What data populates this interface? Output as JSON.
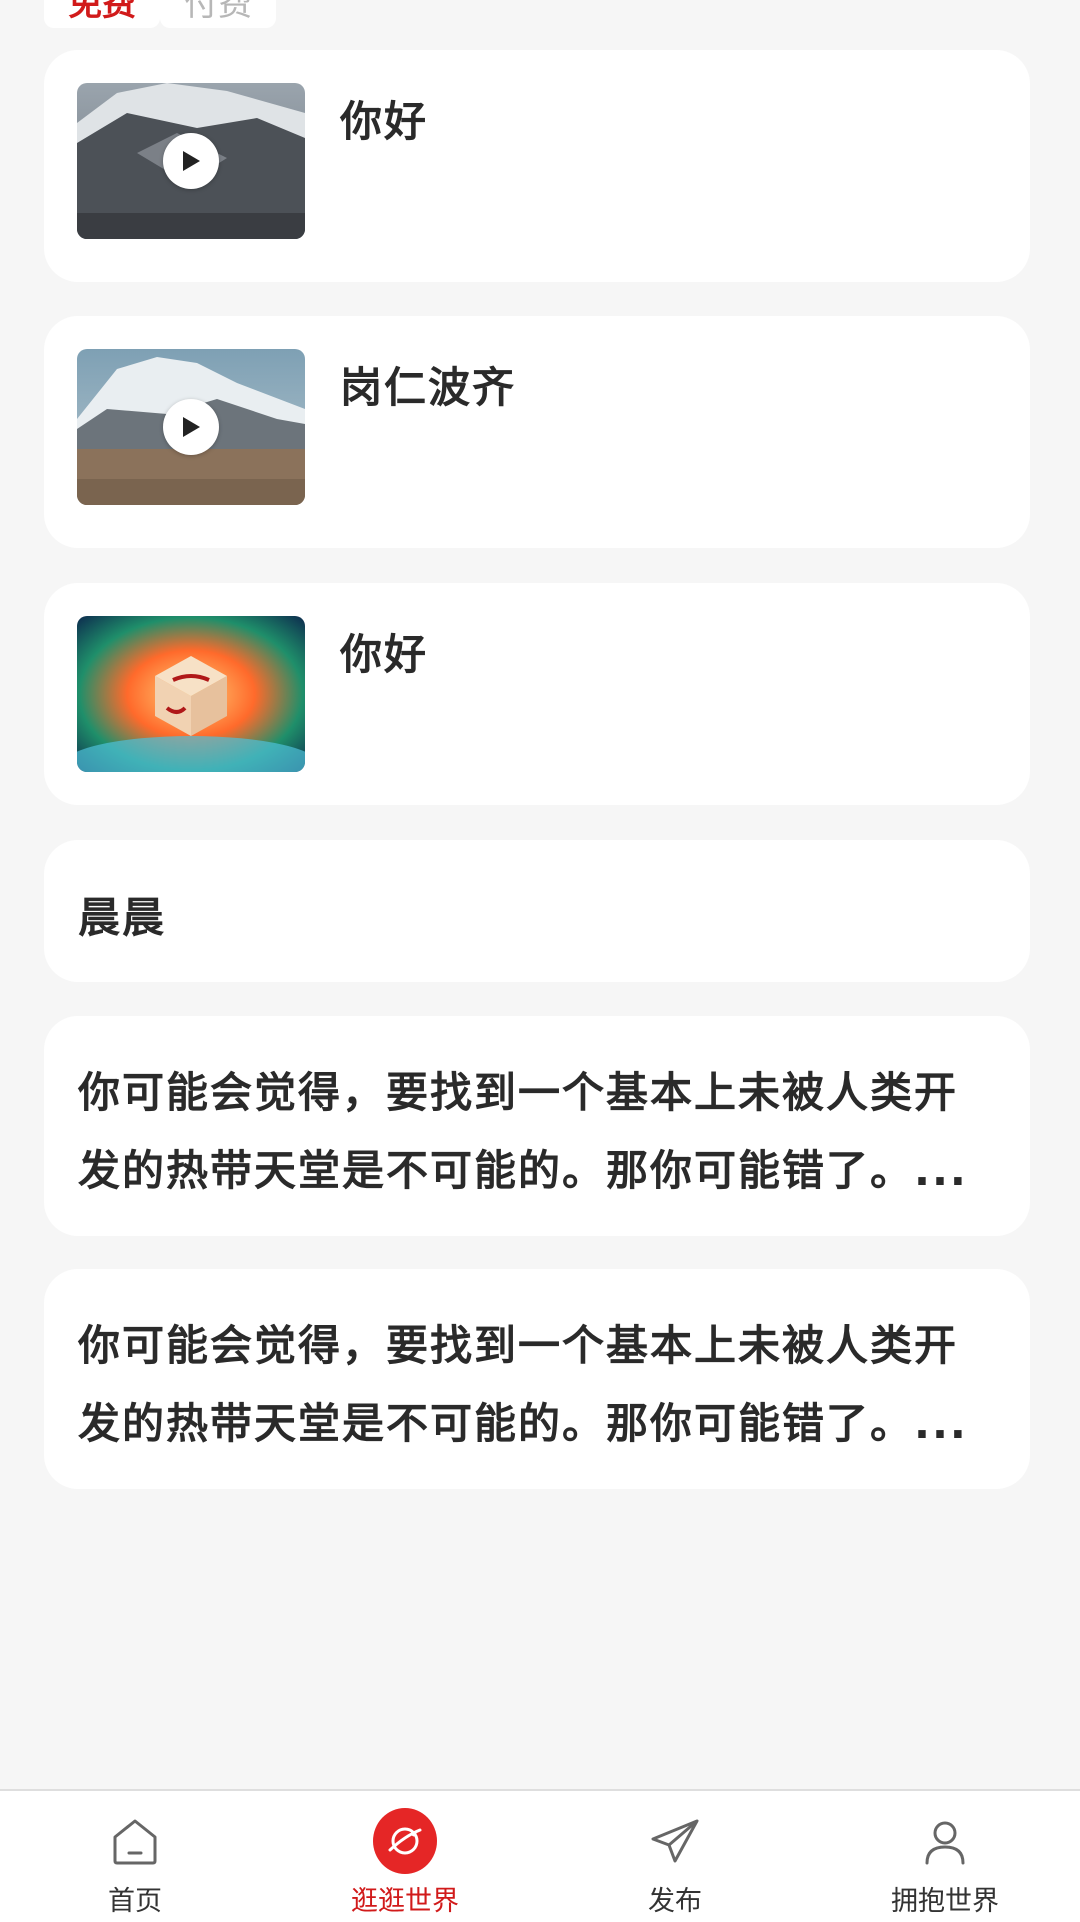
{
  "filters": {
    "active": "免费",
    "inactive": "付费"
  },
  "feed": [
    {
      "type": "video",
      "title": "你好",
      "thumb": "snow-mountain"
    },
    {
      "type": "video",
      "title": "岗仁波齐",
      "thumb": "kailash"
    },
    {
      "type": "image",
      "title": "你好",
      "thumb": "cosmic-cube"
    },
    {
      "type": "text",
      "title": "晨晨"
    },
    {
      "type": "paragraph",
      "text": "你可能会觉得，要找到一个基本上未被人类开发的热带天堂是不可能的。那你可能错了。..."
    },
    {
      "type": "paragraph",
      "text": "你可能会觉得，要找到一个基本上未被人类开发的热带天堂是不可能的。那你可能错了。..."
    }
  ],
  "nav": {
    "items": [
      {
        "label": "首页",
        "icon": "home-icon"
      },
      {
        "label": "逛逛世界",
        "icon": "planet-icon",
        "active": true
      },
      {
        "label": "发布",
        "icon": "send-icon"
      },
      {
        "label": "拥抱世界",
        "icon": "user-icon"
      }
    ]
  },
  "colors": {
    "accent": "#e52626",
    "background": "#f6f6f6",
    "card": "#ffffff"
  }
}
